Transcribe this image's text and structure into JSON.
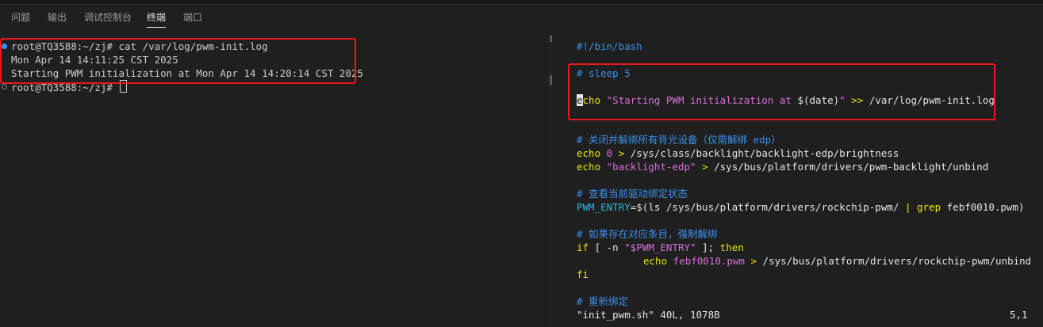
{
  "tabs": [
    "问题",
    "输出",
    "调试控制台",
    "终端",
    "端口"
  ],
  "active_tab": "终端",
  "left_terminal": {
    "lines": [
      "root@TQ3588:~/zj# cat /var/log/pwm-init.log",
      "Mon Apr 14 14:11:25 CST 2025",
      "Starting PWM initialization at Mon Apr 14 14:20:14 CST 2025",
      "root@TQ3588:~/zj# "
    ]
  },
  "right_editor": {
    "shebang": "#!/bin/bash",
    "sleep_comment": "# sleep 5",
    "echo_line": {
      "cursor_char": "e",
      "cmd_rest": "cho",
      "str1": "\"Starting PWM initialization at ",
      "dollar": "$(",
      "date": "date",
      "close": ")",
      "str2": "\"",
      "redirect": ">>",
      "path": "/var/log/pwm-init.log"
    },
    "comment_backlight": "# 关闭并解绑所有背光设备（仅需解绑 edp）",
    "echo0": {
      "cmd": "echo",
      "num": "0",
      "gt": ">",
      "path": "/sys/class/backlight/backlight-edp/brightness"
    },
    "echo_bl": {
      "cmd": "echo",
      "str": "\"backlight-edp\"",
      "gt": ">",
      "path": "/sys/bus/platform/drivers/pwm-backlight/unbind"
    },
    "comment_query": "# 查看当前驱动绑定状态",
    "pwm_entry": {
      "var": "PWM_ENTRY",
      "eq": "=",
      "dollar": "$(",
      "ls": "ls /sys/bus/platform/drivers/rockchip-pwm/",
      "pipe": "|",
      "grep": "grep",
      "arg": "febf0010.pwm",
      "close": ")"
    },
    "comment_if": "# 如果存在对应条目，强制解绑",
    "if_line": {
      "kw_if": "if",
      "open": "[ -n ",
      "str_open": "\"",
      "var": "$PWM_ENTRY",
      "str_close": "\"",
      "close": " ]; ",
      "kw_then": "then"
    },
    "echo_unbind": {
      "cmd": "echo",
      "arg": "febf0010.pwm",
      "gt": ">",
      "path": "/sys/bus/platform/drivers/rockchip-pwm/unbind"
    },
    "fi": "fi",
    "comment_rebind": "# 重新绑定",
    "status_file": "\"init_pwm.sh\" 40L, 1078B",
    "status_pos": "5,1"
  },
  "colors": {
    "highlight_box": "#e8191e",
    "prompt_dot_active": "#3794ff",
    "prompt_dot_idle": "#7f7f7f"
  }
}
